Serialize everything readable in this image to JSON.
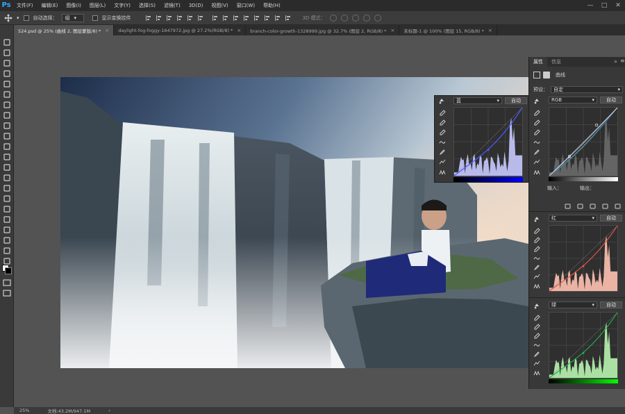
{
  "app": {
    "logo": "Ps"
  },
  "menu": [
    "文件(F)",
    "编辑(E)",
    "图像(I)",
    "图层(L)",
    "文字(Y)",
    "选择(S)",
    "滤镜(T)",
    "3D(D)",
    "视图(V)",
    "窗口(W)",
    "帮助(H)"
  ],
  "window_controls": [
    "—",
    "□",
    "✕"
  ],
  "options": {
    "auto_select_label": "自动选择：",
    "auto_select_value": "组",
    "transform_label": "显示变换控件",
    "mode_3d_label": "3D 模式："
  },
  "tabs": [
    {
      "label": "524.psd @ 25% (曲线 2, 图层蒙版/8) *",
      "active": true
    },
    {
      "label": "daylight-fog-foggy-1647972.jpg @ 27.2%(RGB/8) *",
      "active": false
    },
    {
      "label": "branch-color-growth-1328999.jpg @ 32.7% (图层 2, RGB/8) *",
      "active": false
    },
    {
      "label": "未标题-1 @ 100% (图层 15, RGB/8) *",
      "active": false
    }
  ],
  "floating_curves": {
    "channel": "蓝",
    "auto_label": "自动"
  },
  "properties": {
    "tabs": [
      "属性",
      "信息"
    ],
    "title": "曲线",
    "preset_label": "预设：",
    "preset_value": "自定",
    "channel": "RGB",
    "auto_label": "自动",
    "input_label": "输入：",
    "output_label": "输出："
  },
  "curves_red": {
    "channel": "红",
    "auto_label": "自动"
  },
  "curves_green": {
    "channel": "绿",
    "auto_label": "自动"
  },
  "status": {
    "zoom": "25%",
    "doc_info": "文档:43.2M/947.1M"
  },
  "colors": {
    "blue_curve": "#4a5cff",
    "blue_fill": "#c8caff",
    "red_curve": "#e3574c",
    "red_fill": "#ffc2b0",
    "green_curve": "#22b14c",
    "green_fill": "#b8f5b0"
  }
}
